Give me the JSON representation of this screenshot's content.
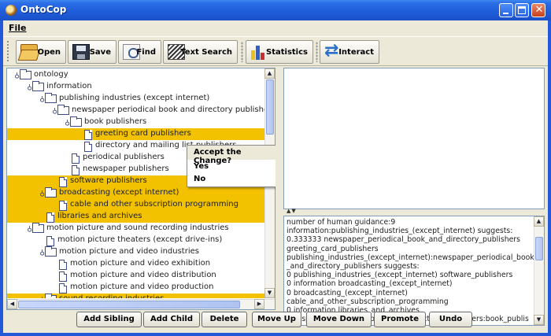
{
  "window": {
    "title": "OntoCop"
  },
  "menu": {
    "file": "File"
  },
  "toolbar": {
    "open": "Open",
    "save": "Save",
    "find": "Find",
    "text_search": "Text Search",
    "statistics": "Statistics",
    "interact": "Interact"
  },
  "tree": [
    {
      "label": "ontology",
      "level": 0,
      "type": "folder",
      "expanded": true,
      "highlight": false
    },
    {
      "label": "information",
      "level": 1,
      "type": "folder",
      "expanded": true,
      "highlight": false
    },
    {
      "label": "publishing industries (except internet)",
      "level": 2,
      "type": "folder",
      "expanded": true,
      "highlight": false
    },
    {
      "label": "newspaper periodical book and directory publishers",
      "level": 3,
      "type": "folder",
      "expanded": true,
      "highlight": false
    },
    {
      "label": "book publishers",
      "level": 4,
      "type": "folder",
      "expanded": true,
      "highlight": false
    },
    {
      "label": "greeting card publishers",
      "level": 5,
      "type": "doc",
      "highlight": true
    },
    {
      "label": "directory and mailing list publishers",
      "level": 5,
      "type": "doc",
      "highlight": false
    },
    {
      "label": "periodical publishers",
      "level": 4,
      "type": "doc",
      "highlight": false
    },
    {
      "label": "newspaper publishers",
      "level": 4,
      "type": "doc",
      "highlight": false
    },
    {
      "label": "software publishers",
      "level": 3,
      "type": "doc",
      "highlight": true
    },
    {
      "label": "broadcasting (except internet)",
      "level": 2,
      "type": "folder",
      "expanded": true,
      "highlight": true
    },
    {
      "label": "cable and other subscription programming",
      "level": 3,
      "type": "doc",
      "highlight": true
    },
    {
      "label": "libraries and archives",
      "level": 2,
      "type": "doc",
      "highlight": true
    },
    {
      "label": "motion picture and sound recording industries",
      "level": 1,
      "type": "folder",
      "expanded": true,
      "highlight": false
    },
    {
      "label": "motion picture theaters (except drive-ins)",
      "level": 2,
      "type": "doc",
      "highlight": false
    },
    {
      "label": "motion picture and video industries",
      "level": 2,
      "type": "folder",
      "expanded": true,
      "highlight": false
    },
    {
      "label": "motion picture and video exhibition",
      "level": 3,
      "type": "doc",
      "highlight": false
    },
    {
      "label": "motion picture and video distribution",
      "level": 3,
      "type": "doc",
      "highlight": false
    },
    {
      "label": "motion picture and video production",
      "level": 3,
      "type": "doc",
      "highlight": false
    },
    {
      "label": "sound recording industries",
      "level": 2,
      "type": "folder",
      "expanded": true,
      "highlight": true
    }
  ],
  "context_menu": {
    "title": "Accept the Change?",
    "yes": "Yes",
    "no": "No"
  },
  "log": [
    "number of human guidance:9",
    "information:publishing_industries_(except_internet) suggests:",
    "0.333333 newspaper_periodical_book_and_directory_publishers",
    "greeting_card_publishers",
    "publishing_industries_(except_internet):newspaper_periodical_book",
    "_and_directory_publishers suggests:",
    "0 publishing_industries_(except_internet) software_publishers",
    "0 information broadcasting_(except_internet)",
    "0 broadcasting_(except_internet)",
    "cable_and_other_subscription_programming",
    "0 information libraries_and_archives",
    "newspaper_periodical_book_and_directory_publishers:book_publis"
  ],
  "buttons": {
    "add_sibling": "Add Sibling",
    "add_child": "Add Child",
    "delete": "Delete",
    "move_up": "Move Up",
    "move_down": "Move Down",
    "promote": "Promote",
    "undo": "Undo"
  }
}
